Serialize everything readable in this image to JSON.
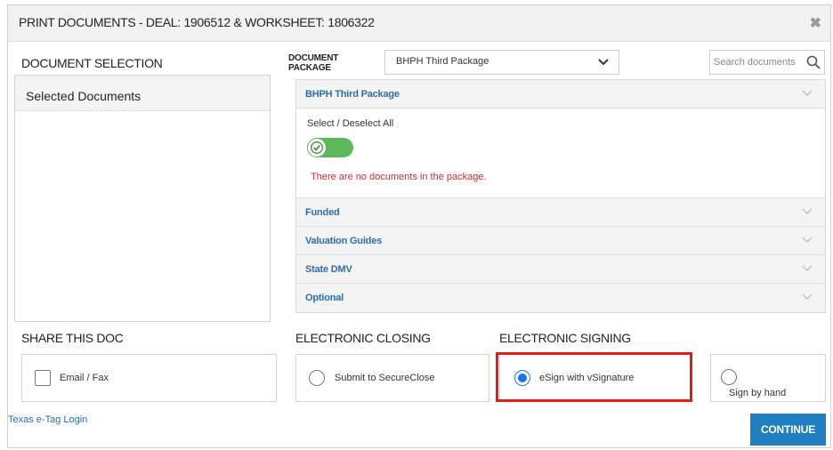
{
  "dialog": {
    "title": "PRINT DOCUMENTS - DEAL: 1906512 & WORKSHEET: 1806322",
    "close_glyph": "✖"
  },
  "document_selection": {
    "heading": "DOCUMENT SELECTION",
    "panel_header": "Selected Documents"
  },
  "document_package": {
    "label_line1": "DOCUMENT",
    "label_line2": "PACKAGE",
    "selected": "BHPH Third Package",
    "search_placeholder": "Search documents"
  },
  "accordion": {
    "expanded": {
      "label": "BHPH Third Package",
      "select_all_label": "Select / Deselect All",
      "toggle_on": true,
      "empty_message": "There are no documents in the package."
    },
    "collapsed": [
      {
        "label": "Funded"
      },
      {
        "label": "Valuation Guides"
      },
      {
        "label": "State DMV"
      },
      {
        "label": "Optional"
      }
    ]
  },
  "share": {
    "heading": "SHARE THIS DOC",
    "email_fax_label": "Email / Fax"
  },
  "electronic_closing": {
    "heading": "ELECTRONIC CLOSING",
    "option_label": "Submit to SecureClose"
  },
  "electronic_signing": {
    "heading": "ELECTRONIC SIGNING",
    "esign_label": "eSign with vSignature",
    "hand_label": "Sign by hand"
  },
  "footer": {
    "texas_link": "Texas e-Tag Login",
    "continue_label": "CONTINUE"
  },
  "colors": {
    "accent": "#1f7fc1",
    "link": "#2b6ea8",
    "toggle": "#5cb85c",
    "error": "#c9302c",
    "highlight": "#e31b1b"
  }
}
